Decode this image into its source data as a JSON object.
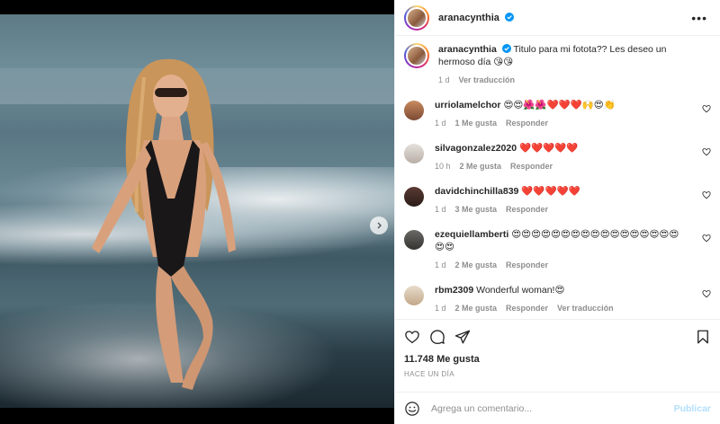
{
  "post": {
    "username": "aranacynthia",
    "verified": true,
    "more_label": "•••"
  },
  "caption": {
    "username": "aranacynthia",
    "text": "Titulo para mi fotota?? Les deseo un hermoso día 😘😘",
    "time": "1 d",
    "translate": "Ver traducción"
  },
  "comments": [
    {
      "username": "urriolamelchor",
      "text": "😍😍🌺🌺❤️❤️❤️🙌😍👏",
      "time": "1 d",
      "likes": "1 Me gusta",
      "reply": "Responder",
      "translate": ""
    },
    {
      "username": "silvagonzalez2020",
      "text": "❤️❤️❤️❤️❤️",
      "time": "10 h",
      "likes": "2 Me gusta",
      "reply": "Responder",
      "translate": ""
    },
    {
      "username": "davidchinchilla839",
      "text": "❤️❤️❤️❤️❤️",
      "time": "1 d",
      "likes": "3 Me gusta",
      "reply": "Responder",
      "translate": ""
    },
    {
      "username": "ezequiellamberti",
      "text": "😍😍😍😍😍😍😍😍😍😍😍😍😍😍😍😍😍😍😍",
      "time": "1 d",
      "likes": "2 Me gusta",
      "reply": "Responder",
      "translate": ""
    },
    {
      "username": "rbm2309",
      "text": "Wonderful woman!😍",
      "time": "1 d",
      "likes": "2 Me gusta",
      "reply": "Responder",
      "translate": "Ver traducción"
    }
  ],
  "stats": {
    "likes": "11.748 Me gusta",
    "posted": "HACE UN DÍA"
  },
  "composer": {
    "placeholder": "Agrega un comentario...",
    "publish": "Publicar"
  },
  "colors": {
    "verified_blue": "#0095f6",
    "publish_disabled": "#b2dffc",
    "muted_text": "#8e8e8e"
  }
}
